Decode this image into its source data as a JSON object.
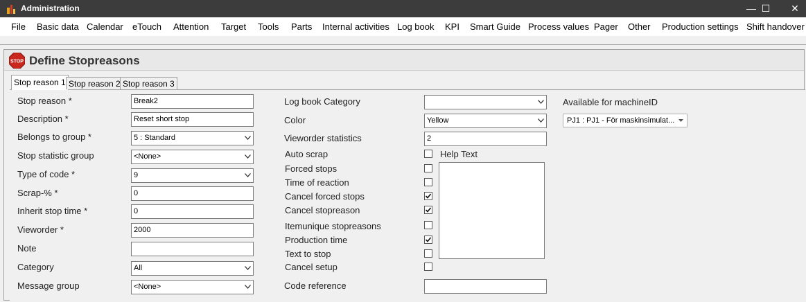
{
  "window": {
    "title": "Administration",
    "controls": {
      "minimize": "—",
      "maximize": "☐",
      "close": "✕"
    }
  },
  "menu": [
    "File",
    "Basic data",
    "Calendar",
    "eTouch",
    "Attention",
    "Target",
    "Tools",
    "Parts",
    "Internal activities",
    "Log book",
    "KPI",
    "Smart Guide",
    "Process values",
    "Pager",
    "Other",
    "Production settings",
    "Shift handover"
  ],
  "header": {
    "title": "Define Stopreasons",
    "icon_text": "STOP"
  },
  "tabs": [
    "Stop reason 1",
    "Stop reason 2",
    "Stop reason 3"
  ],
  "left": {
    "stop_reason": {
      "label": "Stop reason *",
      "value": "Break2"
    },
    "description": {
      "label": "Description *",
      "value": "Reset short stop"
    },
    "belongs_to_group": {
      "label": "Belongs to group *",
      "value": "5 : Standard"
    },
    "stop_statistic_group": {
      "label": "Stop statistic group",
      "value": "<None>"
    },
    "type_of_code": {
      "label": "Type of code *",
      "value": "9"
    },
    "scrap_pct": {
      "label": "Scrap-% *",
      "value": "0"
    },
    "inherit_stop_time": {
      "label": "Inherit stop time *",
      "value": "0"
    },
    "vieworder": {
      "label": "Vieworder *",
      "value": "2000"
    },
    "note": {
      "label": "Note",
      "value": ""
    },
    "category": {
      "label": "Category",
      "value": "All"
    },
    "message_group": {
      "label": "Message group",
      "value": "<None>"
    }
  },
  "middle": {
    "log_book_category": {
      "label": "Log book Category",
      "value": ""
    },
    "color": {
      "label": "Color",
      "value": "Yellow"
    },
    "vieworder_statistics": {
      "label": "Vieworder statistics",
      "value": "2"
    },
    "auto_scrap": {
      "label": "Auto scrap",
      "checked": false
    },
    "forced_stops": {
      "label": "Forced stops",
      "checked": false
    },
    "time_of_reaction": {
      "label": "Time of reaction",
      "checked": false
    },
    "cancel_forced_stops": {
      "label": "Cancel forced stops",
      "checked": true
    },
    "cancel_stopreason": {
      "label": "Cancel stopreason",
      "checked": true
    },
    "itemunique_stopreasons": {
      "label": "Itemunique stopreasons",
      "checked": false
    },
    "production_time": {
      "label": "Production time",
      "checked": true
    },
    "text_to_stop": {
      "label": "Text to stop",
      "checked": false
    },
    "cancel_setup": {
      "label": "Cancel setup",
      "checked": false
    },
    "code_reference": {
      "label": "Code reference",
      "value": ""
    },
    "help_text_label": "Help Text"
  },
  "right": {
    "available_label": "Available for machineID",
    "machine_value": "PJ1 : PJ1 - För maskinsimulat..."
  }
}
